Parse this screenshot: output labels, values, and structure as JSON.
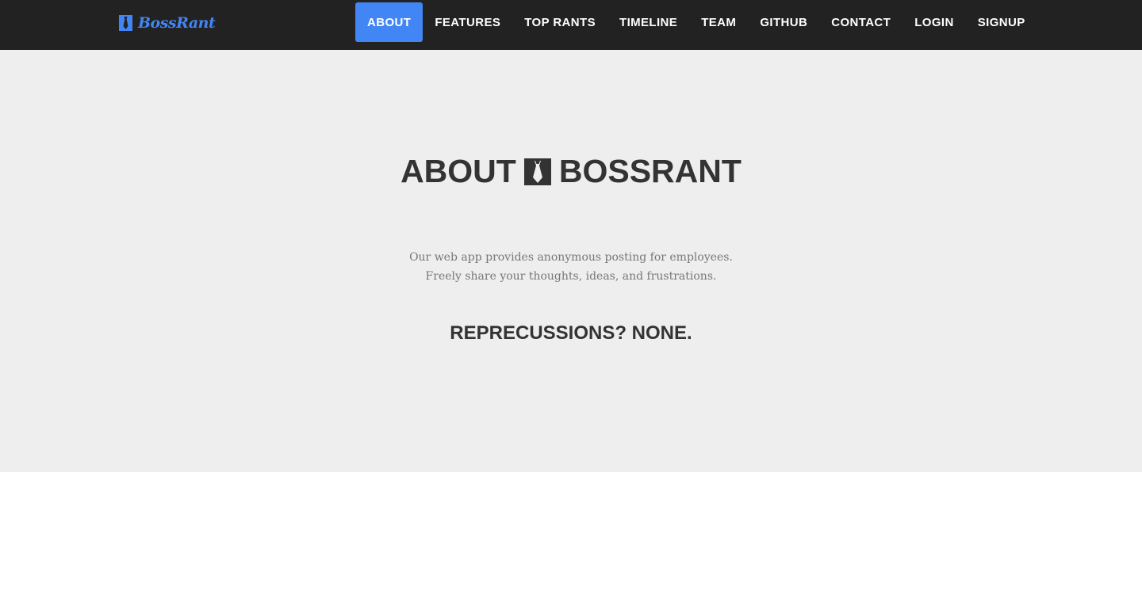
{
  "navbar": {
    "brand": {
      "text": "BossRant",
      "icon": "tie-icon",
      "color": "#4285f4"
    },
    "background": "#222222",
    "accent": "#4285f4",
    "items": [
      {
        "label": "ABOUT",
        "active": true
      },
      {
        "label": "FEATURES",
        "active": false
      },
      {
        "label": "TOP RANTS",
        "active": false
      },
      {
        "label": "TIMELINE",
        "active": false
      },
      {
        "label": "TEAM",
        "active": false
      },
      {
        "label": "GITHUB",
        "active": false
      },
      {
        "label": "CONTACT",
        "active": false
      },
      {
        "label": "LOGIN",
        "active": false
      },
      {
        "label": "SIGNUP",
        "active": false
      }
    ]
  },
  "hero": {
    "title_left": "ABOUT",
    "title_icon": "tie-icon",
    "title_right": "BOSSRANT",
    "description": [
      "Our web app provides anonymous posting for employees.",
      "Freely share your thoughts, ideas, and frustrations."
    ],
    "tagline": "REPRECUSSIONS? NONE.",
    "background": "#eeeeee"
  }
}
